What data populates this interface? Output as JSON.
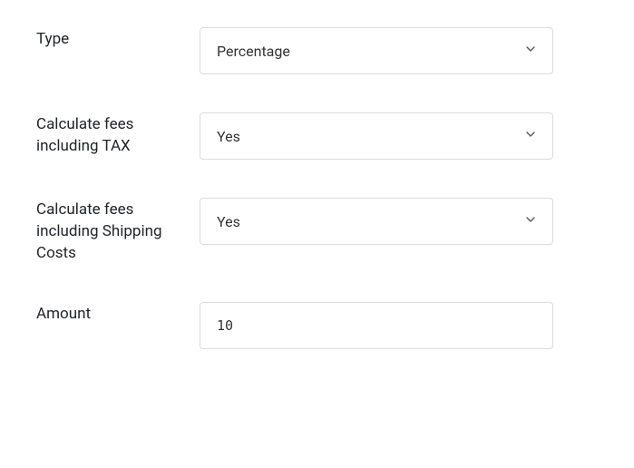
{
  "form": {
    "type": {
      "label": "Type",
      "value": "Percentage"
    },
    "tax": {
      "label": "Calculate fees including TAX",
      "value": "Yes"
    },
    "shipping": {
      "label": "Calculate fees including Shipping Costs",
      "value": "Yes"
    },
    "amount": {
      "label": "Amount",
      "value": "10"
    }
  }
}
